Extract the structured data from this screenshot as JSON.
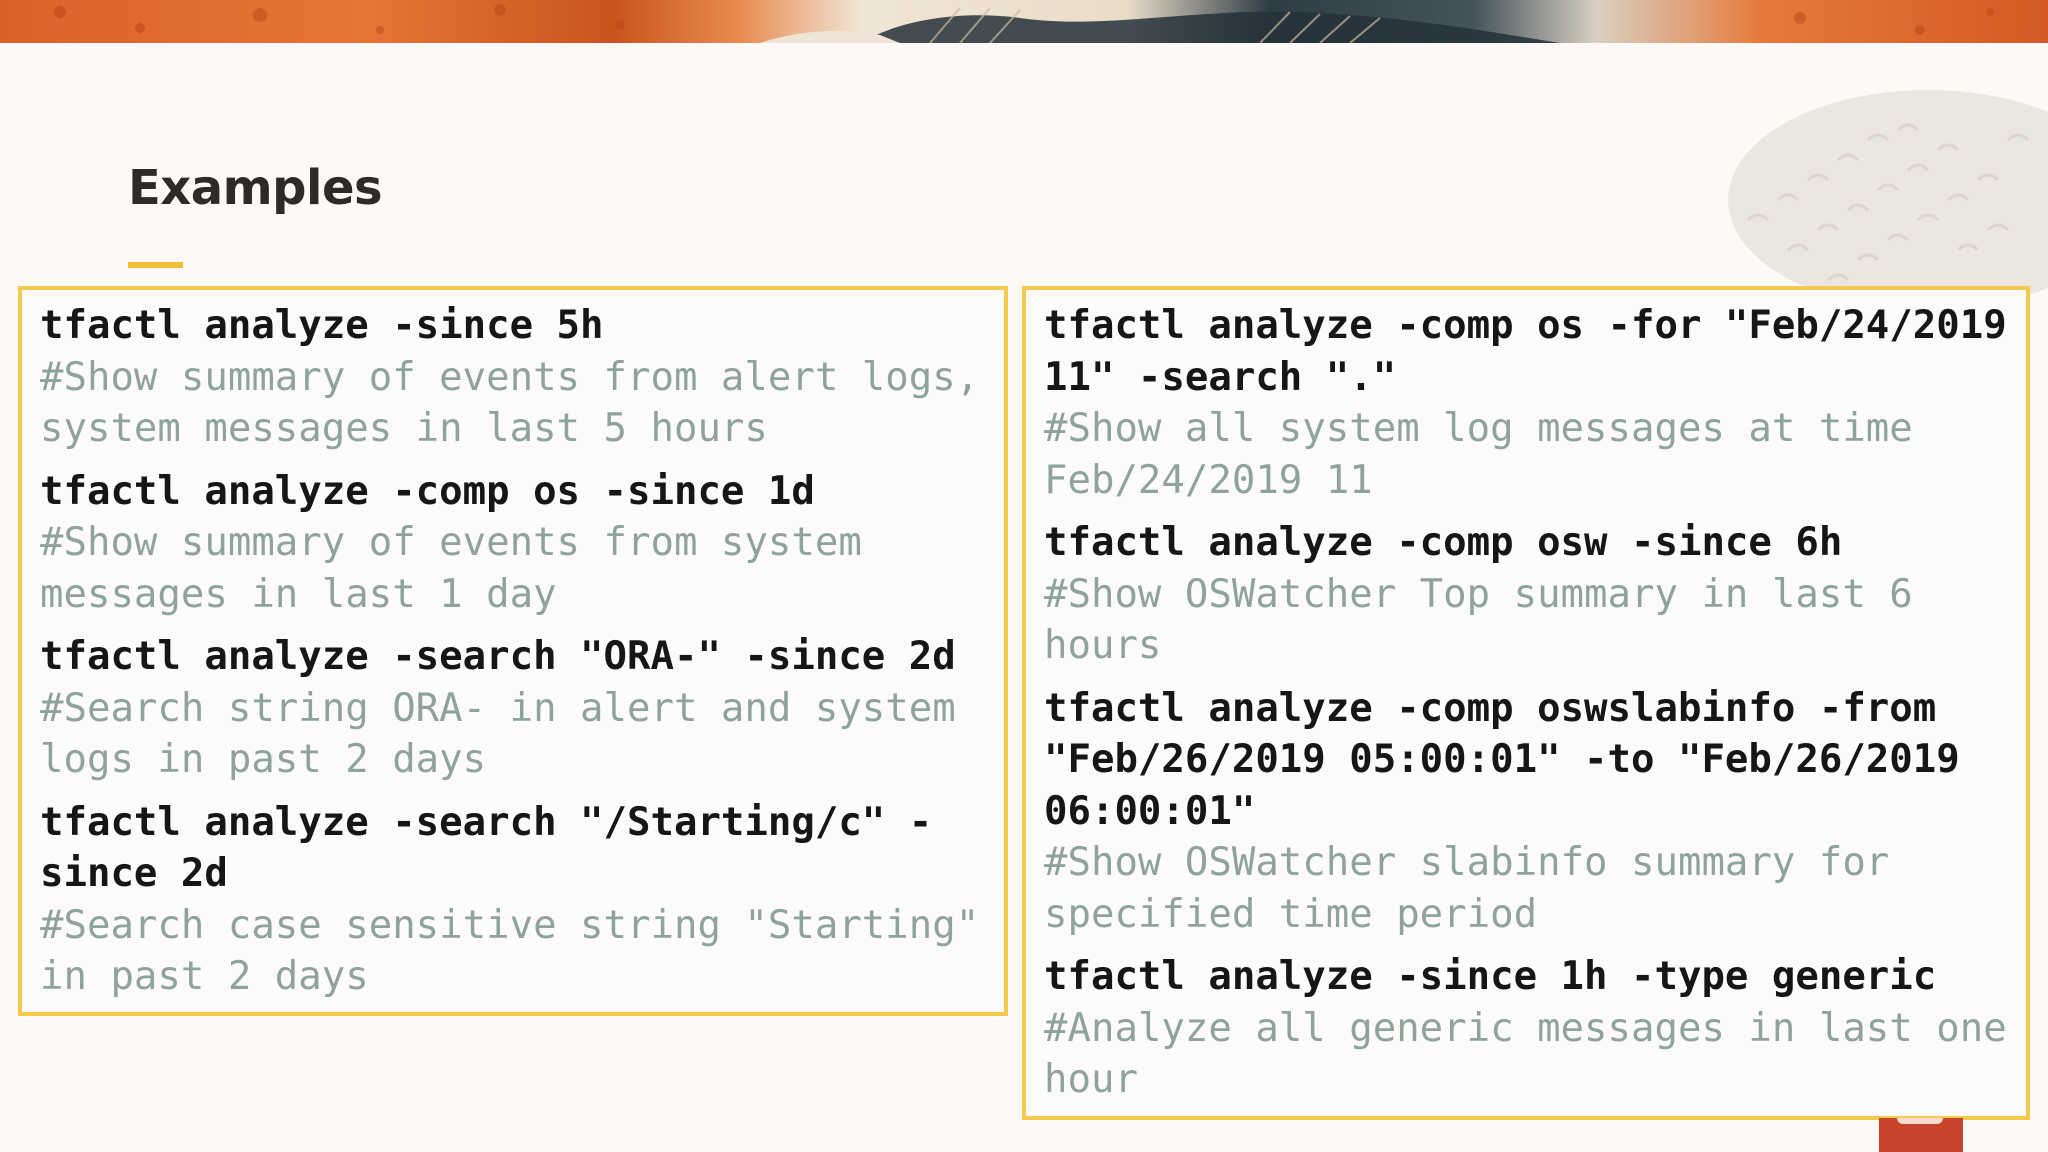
{
  "slide": {
    "title": "Examples",
    "colors": {
      "accent": "#f2be3a",
      "panel_border": "#f5c94e",
      "command_text": "#161616",
      "comment_text": "#8fa39d",
      "background": "#fcf9f7"
    }
  },
  "left_panel": {
    "examples": [
      {
        "command": "tfactl analyze -since 5h",
        "comment": "#Show summary of events from alert logs, system messages in last 5 hours"
      },
      {
        "command": "tfactl analyze -comp os -since 1d",
        "comment": "#Show summary of events from system messages in last 1 day"
      },
      {
        "command": "tfactl analyze -search \"ORA-\" -since 2d",
        "comment": "#Search string ORA- in alert and system logs in past 2 days"
      },
      {
        "command": "tfactl analyze -search \"/Starting/c\" - since 2d",
        "comment": "#Search case sensitive string \"Starting\" in past 2 days"
      }
    ]
  },
  "right_panel": {
    "examples": [
      {
        "command": "tfactl analyze -comp os -for \"Feb/24/2019 11\" -search \".\"",
        "comment": "#Show all system log messages at time Feb/24/2019 11"
      },
      {
        "command": "tfactl analyze -comp osw -since 6h",
        "comment": "#Show OSWatcher Top summary in last 6 hours"
      },
      {
        "command": "tfactl analyze -comp oswslabinfo -from \"Feb/26/2019 05:00:01\" -to \"Feb/26/2019 06:00:01\"",
        "comment": "#Show OSWatcher slabinfo summary for specified time period"
      },
      {
        "command": "tfactl analyze -since 1h -type generic",
        "comment": "#Analyze all generic messages in last one hour"
      }
    ]
  }
}
